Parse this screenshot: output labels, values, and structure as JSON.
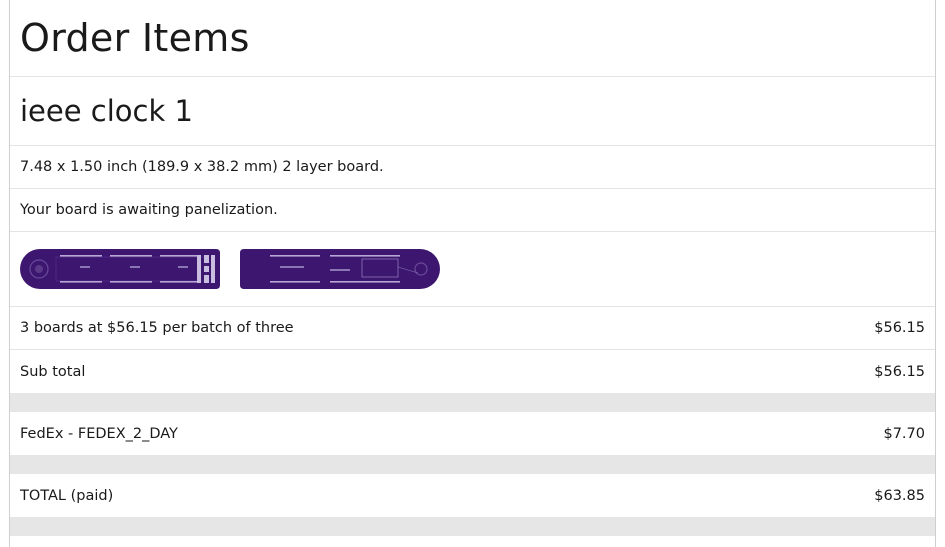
{
  "page": {
    "heading": "Order Items"
  },
  "order_item": {
    "name": "ieee clock 1",
    "dimensions": "7.48 x 1.50 inch (189.9 x 38.2 mm) 2 layer board.",
    "status": "Your board is awaiting panelization.",
    "previews": [
      {
        "side": "top",
        "color": "#3d1670"
      },
      {
        "side": "bottom",
        "color": "#3d1670"
      }
    ]
  },
  "pricing": {
    "line_item": {
      "label": "3 boards at $56.15 per batch of three",
      "amount": "$56.15"
    },
    "subtotal": {
      "label": "Sub total",
      "amount": "$56.15"
    },
    "shipping": {
      "label": "FedEx - FEDEX_2_DAY",
      "amount": "$7.70"
    },
    "total": {
      "label": "TOTAL (paid)",
      "amount": "$63.85"
    }
  },
  "colors": {
    "board_purple": "#3d1670",
    "gap_gray": "#e6e6e6",
    "border": "#e4e4e4"
  }
}
